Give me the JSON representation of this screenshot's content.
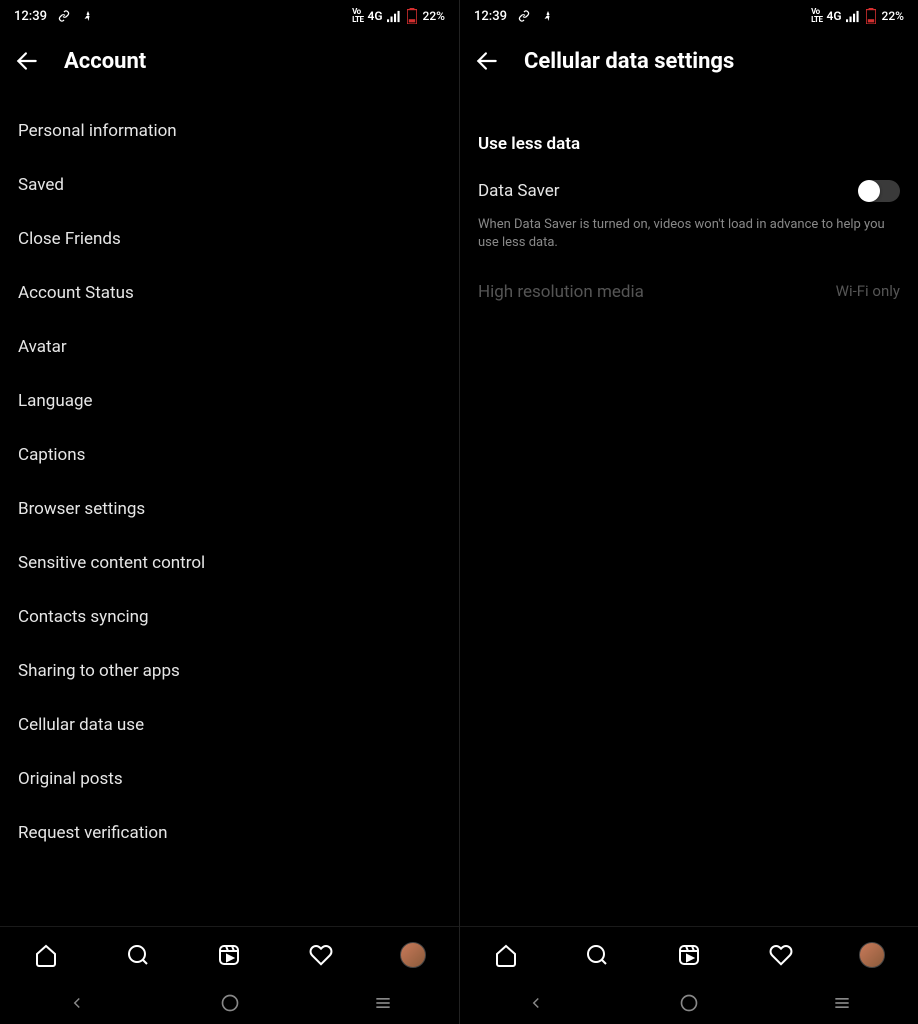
{
  "status": {
    "time": "12:39",
    "network_type": "4G",
    "battery_text": "22%"
  },
  "leftScreen": {
    "title": "Account",
    "items": [
      "Personal information",
      "Saved",
      "Close Friends",
      "Account Status",
      "Avatar",
      "Language",
      "Captions",
      "Browser settings",
      "Sensitive content control",
      "Contacts syncing",
      "Sharing to other apps",
      "Cellular data use",
      "Original posts",
      "Request verification"
    ]
  },
  "rightScreen": {
    "title": "Cellular data settings",
    "section": "Use less data",
    "toggle_label": "Data Saver",
    "description": "When Data Saver is turned on, videos won't load in advance to help you use less data.",
    "sub_label": "High resolution media",
    "sub_value": "Wi-Fi only"
  }
}
